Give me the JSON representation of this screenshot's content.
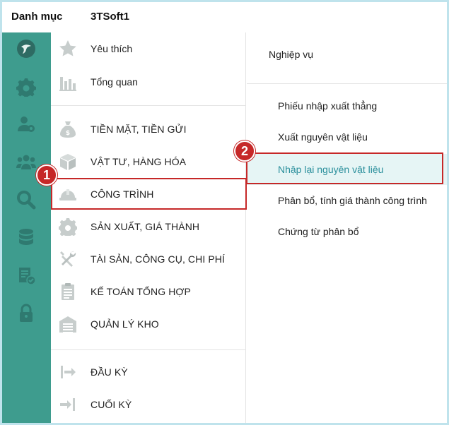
{
  "topbar": {
    "category_label": "Danh mục",
    "org_name": "3TSoft1"
  },
  "rail": {
    "items": [
      {
        "icon": "logo-icon"
      },
      {
        "icon": "gear-icon"
      },
      {
        "icon": "user-settings-icon"
      },
      {
        "icon": "users-icon"
      },
      {
        "icon": "search-icon"
      },
      {
        "icon": "database-icon"
      },
      {
        "icon": "report-check-icon"
      },
      {
        "icon": "lock-icon"
      }
    ]
  },
  "menu": {
    "items": [
      {
        "label": "Yêu thích",
        "icon": "star-icon"
      },
      {
        "label": "Tổng quan",
        "icon": "bar-chart-icon"
      },
      {
        "label": "TIỀN MẶT, TIỀN GỬI",
        "icon": "money-bag-icon"
      },
      {
        "label": "VẬT TƯ, HÀNG HÓA",
        "icon": "box-icon"
      },
      {
        "label": "CÔNG TRÌNH",
        "icon": "hardhat-icon"
      },
      {
        "label": "SẢN XUẤT, GIÁ THÀNH",
        "icon": "gear-icon"
      },
      {
        "label": "TÀI SẢN, CÔNG CỤ, CHI PHÍ",
        "icon": "tools-icon"
      },
      {
        "label": "KẾ TOÁN TỔNG HỢP",
        "icon": "clipboard-icon"
      },
      {
        "label": "QUẢN LÝ KHO",
        "icon": "warehouse-icon"
      },
      {
        "label": "ĐẦU KỲ",
        "icon": "arrow-right-bar-icon"
      },
      {
        "label": "CUỐI KỲ",
        "icon": "arrow-into-bar-icon"
      }
    ]
  },
  "right": {
    "header": "Nghiệp vụ",
    "items": [
      {
        "label": "Phiếu nhập xuất thẳng"
      },
      {
        "label": "Xuất nguyên vật liệu"
      },
      {
        "label": "Nhập lại nguyên vật liệu"
      },
      {
        "label": "Phân bổ, tính giá thành công trình"
      },
      {
        "label": "Chứng từ phân bổ"
      }
    ]
  },
  "annotations": {
    "badge1": "1",
    "badge2": "2"
  },
  "colors": {
    "rail": "#3e9c8e",
    "highlight": "#c62828",
    "active_bg": "#e6f5f5",
    "active_text": "#2a8f9c",
    "icon_gray": "#c7cdcc"
  }
}
